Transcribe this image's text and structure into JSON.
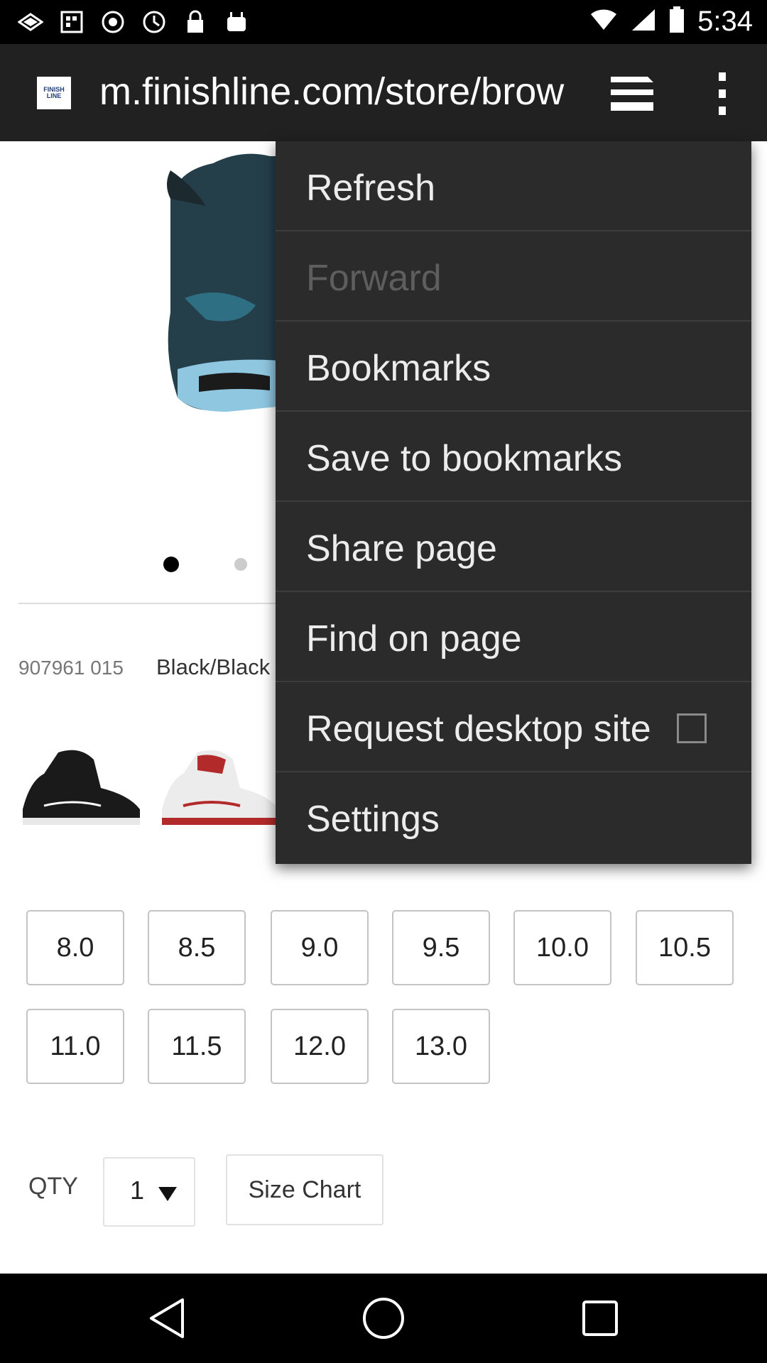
{
  "status_bar": {
    "time": "5:34",
    "left_icons": [
      "photo-icon",
      "gallery-icon",
      "game-icon",
      "nvidia-icon",
      "lock-icon",
      "android-icon"
    ],
    "right_icons": [
      "wifi-icon",
      "signal-icon",
      "battery-icon"
    ]
  },
  "url_bar": {
    "favicon_text": "FINISH LINE",
    "url": "m.finishline.com/store/brow"
  },
  "product": {
    "sku": "907961 015",
    "color": "Black/Black",
    "sizes": [
      "8.0",
      "8.5",
      "9.0",
      "9.5",
      "10.0",
      "10.5",
      "11.0",
      "11.5",
      "12.0",
      "13.0"
    ],
    "qty_label": "QTY",
    "qty_value": "1",
    "size_chart_label": "Size Chart"
  },
  "menu": {
    "items": [
      {
        "label": "Refresh",
        "enabled": true
      },
      {
        "label": "Forward",
        "enabled": false
      },
      {
        "label": "Bookmarks",
        "enabled": true
      },
      {
        "label": "Save to bookmarks",
        "enabled": true
      },
      {
        "label": "Share page",
        "enabled": true
      },
      {
        "label": "Find on page",
        "enabled": true
      },
      {
        "label": "Request desktop site",
        "enabled": true,
        "checked": false
      },
      {
        "label": "Settings",
        "enabled": true
      }
    ]
  },
  "nav_bar": {
    "buttons": [
      "back-icon",
      "home-icon",
      "recents-icon"
    ]
  },
  "colors": {
    "status_bar": "#000000",
    "url_bar": "#212121",
    "menu_bg": "#2b2b2b",
    "menu_text": "#ececec",
    "menu_text_disabled": "#5e5e5e"
  }
}
